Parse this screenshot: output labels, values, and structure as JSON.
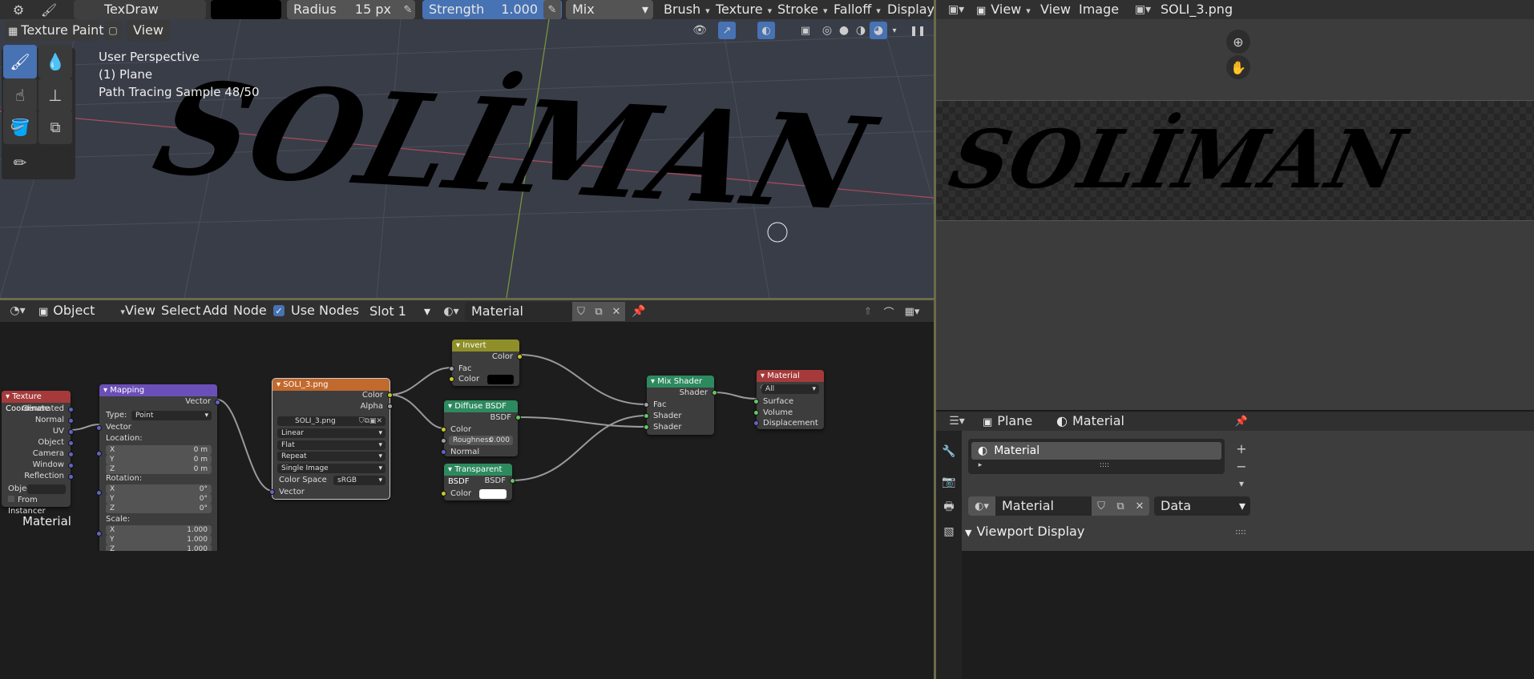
{
  "header": {
    "brush_name": "TexDraw",
    "radius_label": "Radius",
    "radius_value": "15 px",
    "strength_label": "Strength",
    "strength_value": "1.000",
    "blend_mode": "Mix",
    "menus": [
      "Brush",
      "Texture",
      "Stroke",
      "Falloff",
      "Display"
    ],
    "mode": "Texture Paint",
    "view": "View"
  },
  "viewport": {
    "info": [
      "User Perspective",
      "(1) Plane",
      "Path Tracing Sample 48/50"
    ],
    "painted_text": "SOLİMAN"
  },
  "image_editor": {
    "view_label": "View",
    "menus": [
      "View",
      "Image"
    ],
    "image_name": "SOLI_3.png"
  },
  "node_editor": {
    "editor_type": "Object",
    "menus": [
      "View",
      "Select",
      "Add",
      "Node"
    ],
    "use_nodes": "Use Nodes",
    "slot": "Slot 1",
    "material": "Material",
    "material_label": "Material",
    "nodes": {
      "texcoord": {
        "title": "Texture Coordinate",
        "outputs": [
          "Generated",
          "Normal",
          "UV",
          "Object",
          "Camera",
          "Window",
          "Reflection"
        ],
        "object_label": "Objec",
        "from_instancer": "From Instancer"
      },
      "mapping": {
        "title": "Mapping",
        "vector_out": "Vector",
        "type_label": "Type:",
        "type_value": "Point",
        "vector_in": "Vector",
        "location": "Location:",
        "rotation": "Rotation:",
        "scale": "Scale:",
        "loc": [
          [
            "X",
            "0 m"
          ],
          [
            "Y",
            "0 m"
          ],
          [
            "Z",
            "0 m"
          ]
        ],
        "rot": [
          [
            "X",
            "0°"
          ],
          [
            "Y",
            "0°"
          ],
          [
            "Z",
            "0°"
          ]
        ],
        "scl": [
          [
            "X",
            "1.000"
          ],
          [
            "Y",
            "1.000"
          ],
          [
            "Z",
            "1.000"
          ]
        ]
      },
      "image": {
        "title": "SOLI_3.png",
        "color": "Color",
        "alpha": "Alpha",
        "file": "SOLI_3.png",
        "interp": "Linear",
        "proj": "Flat",
        "ext": "Repeat",
        "source": "Single Image",
        "cs_label": "Color Space",
        "cs_value": "sRGB",
        "vector": "Vector"
      },
      "invert": {
        "title": "Invert",
        "color_out": "Color",
        "fac": "Fac",
        "color": "Color"
      },
      "diffuse": {
        "title": "Diffuse BSDF",
        "bsdf": "BSDF",
        "color": "Color",
        "rough_label": "Roughness",
        "rough_value": "0.000",
        "normal": "Normal"
      },
      "transparent": {
        "title": "Transparent BSDF",
        "bsdf": "BSDF",
        "color": "Color"
      },
      "mix": {
        "title": "Mix Shader",
        "shader_out": "Shader",
        "fac": "Fac",
        "shader1": "Shader",
        "shader2": "Shader"
      },
      "output": {
        "title": "Material Output",
        "target": "All",
        "surface": "Surface",
        "volume": "Volume",
        "displacement": "Displacement"
      }
    }
  },
  "properties": {
    "object": "Plane",
    "material_crumb": "Material",
    "slot_item": "Material",
    "material_field": "Material",
    "link": "Data",
    "panel": "Viewport Display"
  },
  "colors": {
    "accent": "#4772b3",
    "texcoord": "#a63a3a",
    "mapping": "#6b4fb8",
    "image": "#c26a2e",
    "invert": "#8f8f2a",
    "shader": "#2d8a5f",
    "output": "#a63a3a"
  }
}
